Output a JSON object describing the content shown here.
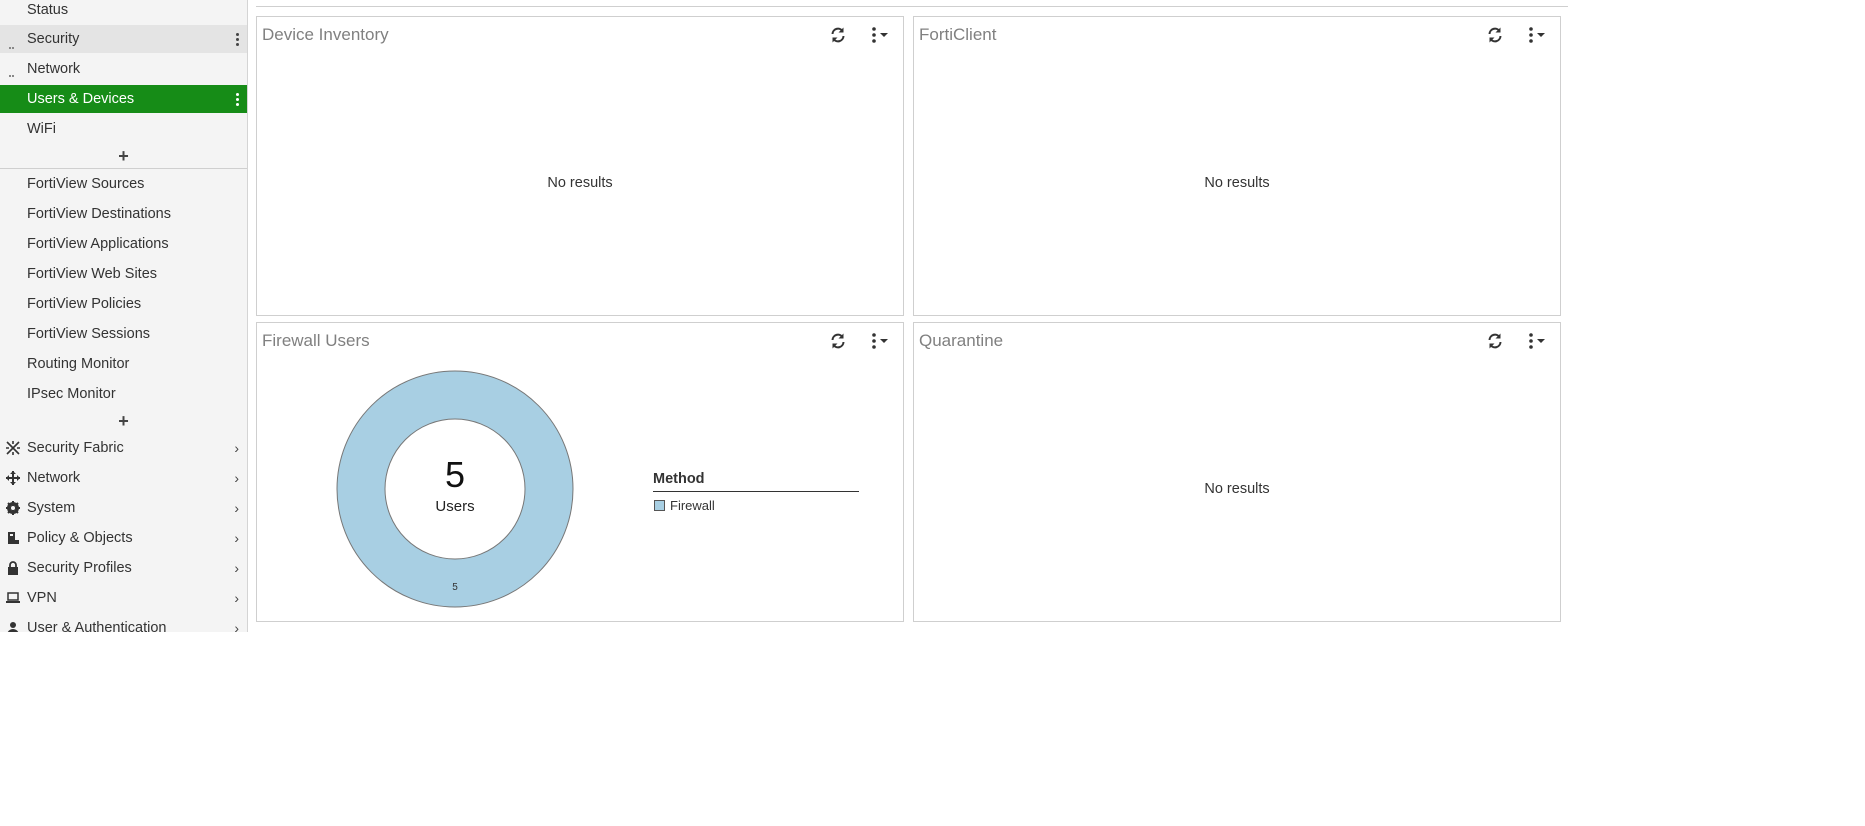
{
  "sidebar": {
    "dashboards": [
      {
        "label": "Status"
      },
      {
        "label": "Security"
      },
      {
        "label": "Network"
      },
      {
        "label": "Users & Devices"
      },
      {
        "label": "WiFi"
      }
    ],
    "monitors": [
      {
        "label": "FortiView Sources"
      },
      {
        "label": "FortiView Destinations"
      },
      {
        "label": "FortiView Applications"
      },
      {
        "label": "FortiView Web Sites"
      },
      {
        "label": "FortiView Policies"
      },
      {
        "label": "FortiView Sessions"
      },
      {
        "label": "Routing Monitor"
      },
      {
        "label": "IPsec Monitor"
      }
    ],
    "menu": [
      {
        "label": "Security Fabric",
        "icon": "security-fabric-icon"
      },
      {
        "label": "Network",
        "icon": "network-icon"
      },
      {
        "label": "System",
        "icon": "gear-icon"
      },
      {
        "label": "Policy & Objects",
        "icon": "policy-icon"
      },
      {
        "label": "Security Profiles",
        "icon": "lock-icon"
      },
      {
        "label": "VPN",
        "icon": "laptop-icon"
      },
      {
        "label": "User & Authentication",
        "icon": "user-icon"
      }
    ],
    "add_symbol": "+",
    "chevron": "›"
  },
  "widgets": {
    "device_inventory": {
      "title": "Device Inventory",
      "empty": "No results"
    },
    "forticlient": {
      "title": "FortiClient",
      "empty": "No results"
    },
    "firewall_users": {
      "title": "Firewall Users",
      "total": "5",
      "total_label": "Users",
      "legend_title": "Method",
      "legend_items": [
        {
          "label": "Firewall",
          "color": "#a8cfe3"
        }
      ]
    },
    "quarantine": {
      "title": "Quarantine",
      "empty": "No results"
    }
  },
  "chart_data": {
    "type": "pie",
    "title": "",
    "categories": [
      "Firewall"
    ],
    "values": [
      5
    ],
    "legend": "right",
    "colors": [
      "#a8cfe3"
    ]
  },
  "colors": {
    "accent": "#168c17",
    "donut": "#a8cfe3"
  }
}
